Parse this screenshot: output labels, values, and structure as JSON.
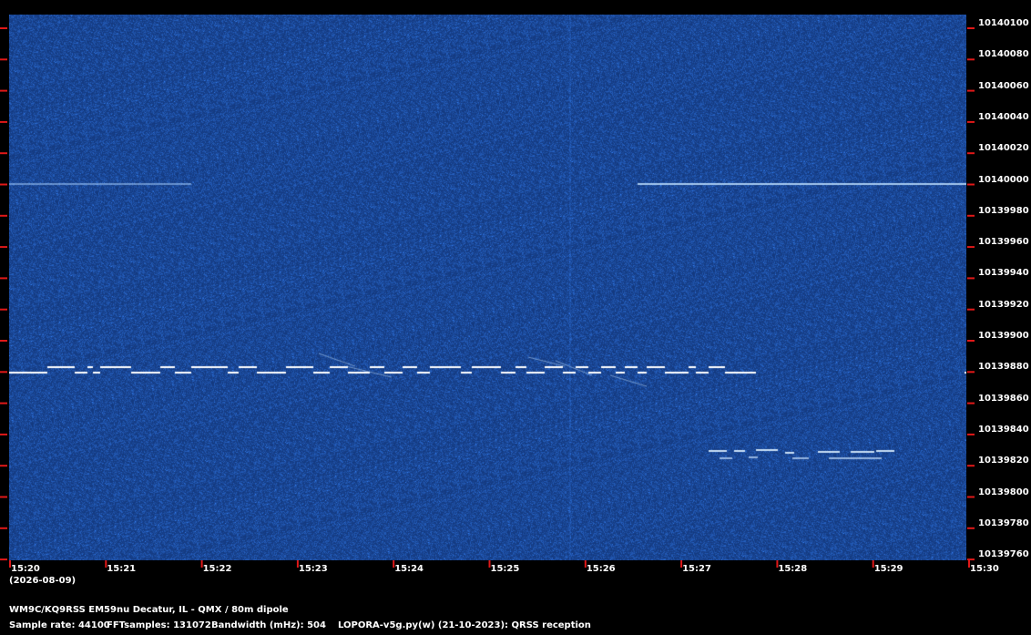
{
  "spectrogram": {
    "freq_labels": [
      "10140100",
      "10140080",
      "10140060",
      "10140040",
      "10140020",
      "10140000",
      "10139980",
      "10139960",
      "10139940",
      "10139920",
      "10139900",
      "10139880",
      "10139860",
      "10139840",
      "10139820",
      "10139800",
      "10139780",
      "10139760"
    ],
    "time_labels": [
      "15:20",
      "15:21",
      "15:22",
      "15:23",
      "15:24",
      "15:25",
      "15:26",
      "15:27",
      "15:28",
      "15:29",
      "15:30"
    ],
    "date_label": "(2026-08-09)",
    "background_color": "#0a2a6e",
    "tick_color": "#e01818",
    "signal_color": "#ffffff"
  },
  "footer": {
    "station": "WM9C/KQ9RSS EM59nu Decatur, IL - QMX / 80m dipole",
    "sample_rate": "Sample rate: 44100",
    "fft_samples": "FFTsamples: 131072",
    "bandwidth": "Bandwidth (mHz): 504",
    "software": "LOPORA-v5g.py(w) (21-10-2023): QRSS reception"
  }
}
